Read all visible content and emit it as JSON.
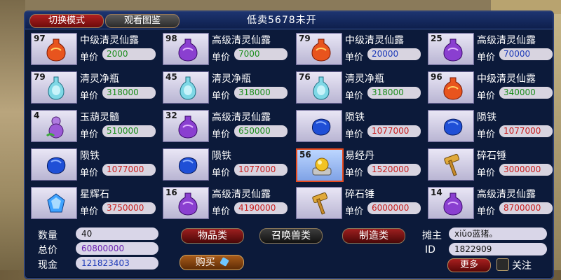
{
  "header": {
    "mode_button": "切换模式",
    "guide_button": "观看图鉴",
    "title": "低卖5678未开"
  },
  "price_label": "单价",
  "items": [
    {
      "qty": "97",
      "name": "中级清灵仙露",
      "price": "2000",
      "icon": "red-potion-icon",
      "price_color": "green"
    },
    {
      "qty": "98",
      "name": "高级清灵仙露",
      "price": "7000",
      "icon": "purple-potion-icon",
      "price_color": "green"
    },
    {
      "qty": "79",
      "name": "中级清灵仙露",
      "price": "20000",
      "icon": "red-potion-icon",
      "price_color": "blue"
    },
    {
      "qty": "25",
      "name": "高级清灵仙露",
      "price": "70000",
      "icon": "purple-potion-icon",
      "price_color": "blue"
    },
    {
      "qty": "79",
      "name": "清灵净瓶",
      "price": "318000",
      "icon": "cyan-vase-icon",
      "price_color": "green"
    },
    {
      "qty": "45",
      "name": "清灵净瓶",
      "price": "318000",
      "icon": "cyan-vase-icon",
      "price_color": "green"
    },
    {
      "qty": "76",
      "name": "清灵净瓶",
      "price": "318000",
      "icon": "cyan-vase-icon",
      "price_color": "green"
    },
    {
      "qty": "96",
      "name": "中级清灵仙露",
      "price": "340000",
      "icon": "red-potion-icon",
      "price_color": "green"
    },
    {
      "qty": "4",
      "name": "玉葫灵髓",
      "price": "510000",
      "icon": "gourd-icon",
      "price_color": "green"
    },
    {
      "qty": "32",
      "name": "高级清灵仙露",
      "price": "650000",
      "icon": "purple-potion-icon",
      "price_color": "green"
    },
    {
      "qty": "",
      "name": "陨铁",
      "price": "1077000",
      "icon": "meteor-iron-icon",
      "price_color": "red"
    },
    {
      "qty": "",
      "name": "陨铁",
      "price": "1077000",
      "icon": "meteor-iron-icon",
      "price_color": "red"
    },
    {
      "qty": "",
      "name": "陨铁",
      "price": "1077000",
      "icon": "meteor-iron-icon",
      "price_color": "red"
    },
    {
      "qty": "",
      "name": "陨铁",
      "price": "1077000",
      "icon": "meteor-iron-icon",
      "price_color": "red"
    },
    {
      "qty": "56",
      "name": "易经丹",
      "price": "1520000",
      "icon": "golden-pill-icon",
      "price_color": "red",
      "selected": true
    },
    {
      "qty": "",
      "name": "碎石锤",
      "price": "3000000",
      "icon": "hammer-icon",
      "price_color": "red"
    },
    {
      "qty": "",
      "name": "星辉石",
      "price": "3750000",
      "icon": "blue-gem-icon",
      "price_color": "red"
    },
    {
      "qty": "16",
      "name": "高级清灵仙露",
      "price": "4190000",
      "icon": "purple-potion-icon",
      "price_color": "red"
    },
    {
      "qty": "",
      "name": "碎石锤",
      "price": "6000000",
      "icon": "hammer-icon",
      "price_color": "red"
    },
    {
      "qty": "14",
      "name": "高级清灵仙露",
      "price": "8700000",
      "icon": "purple-potion-icon",
      "price_color": "red"
    }
  ],
  "footer": {
    "quantity_label": "数量",
    "quantity_value": "40",
    "total_label": "总价",
    "total_value": "60800000",
    "cash_label": "现金",
    "cash_value": "121823403",
    "tab_items": "物品类",
    "tab_summon": "召唤兽类",
    "tab_craft": "制造类",
    "buy_button": "购买",
    "owner_label": "摊主",
    "owner_value": "xiǔo蓝猪。",
    "id_label": "ID",
    "id_value": "1822909",
    "more_button": "更多",
    "follow_label": "关注"
  },
  "colors": {
    "panel": "#0c1a3a",
    "price_green": "#1b8e1b",
    "price_red": "#c81e1e",
    "price_blue": "#1c39b8"
  }
}
